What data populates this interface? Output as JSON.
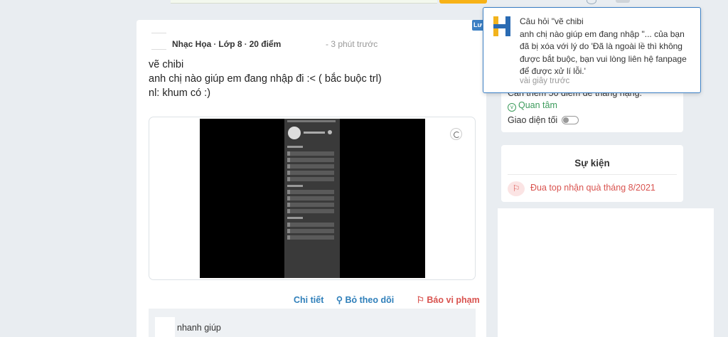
{
  "post": {
    "author": "Nhạc Họa",
    "grade": "Lớp 8",
    "points": "20 điểm",
    "time": "- 3 phút trước",
    "title": "vẽ chibi",
    "body": "anh chị nào giúp em đang nhập đi :< ( bắc buộc trl)",
    "note": "nl: khum có :)",
    "actions": {
      "detail": "Chi tiết",
      "unfollow": "Bỏ theo dõi",
      "report": "Báo vi phạm"
    },
    "comment_preview": "nhanh giúp"
  },
  "sidebar": {
    "rank_text": "Cần thêm 50 điểm để thăng hạng.",
    "follow": "Quan tâm",
    "dark_mode": "Giao diện tối"
  },
  "events": {
    "title": "Sự kiện",
    "item": "Đua top nhận quà tháng 8/2021"
  },
  "badge": {
    "label": "Lư"
  },
  "notification": {
    "line1": "Câu hỏi \"vẽ chibi",
    "line2": "anh chị nào giúp em đang nhập  \"... của bạn",
    "line3": "đã bị xóa với lý do 'Đã là ngoài lề thì không",
    "line4": "được bắt buộc, bạn vui lòng liên hệ fanpage",
    "line5": "để được xử lí lỗi.'",
    "time": "vài giây trước"
  },
  "colors": {
    "accent_blue": "#2f7fba",
    "report_red": "#d9534f",
    "follow_green": "#3c9b5c",
    "logo_yellow": "#f2b31c",
    "logo_blue": "#2a6bb3"
  }
}
